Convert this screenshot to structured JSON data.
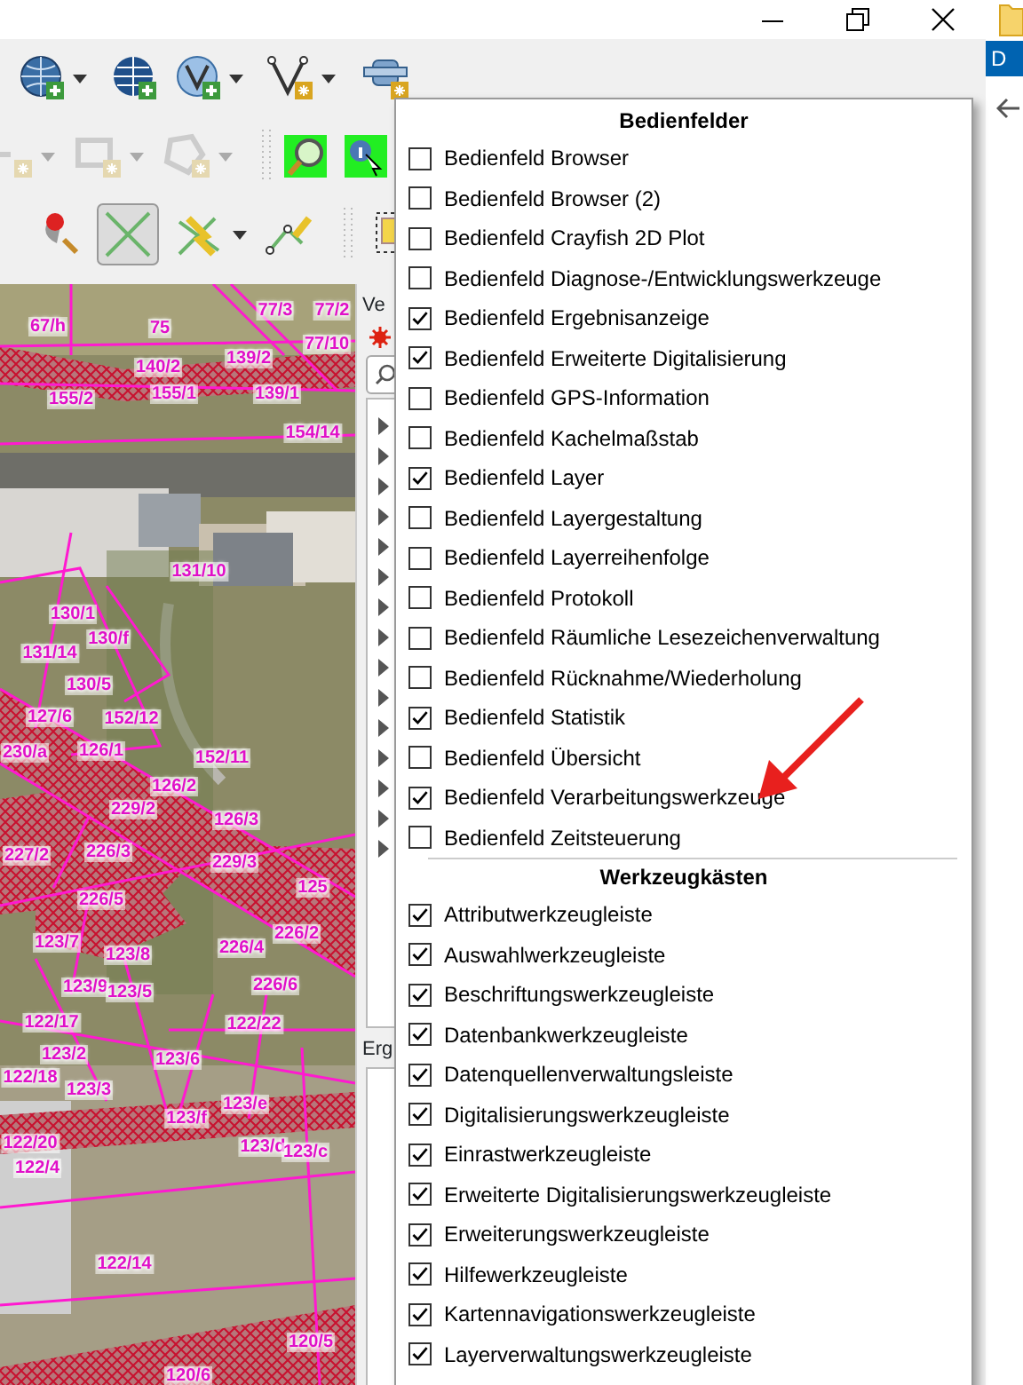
{
  "map": {
    "parcel_labels": [
      "67/h",
      "75",
      "77/3",
      "77/2",
      "77/10",
      "140/2",
      "139/2",
      "155/2",
      "155/1",
      "139/1",
      "154/14",
      "131/10",
      "130/1",
      "130/f",
      "131/14",
      "130/5",
      "127/6",
      "152/12",
      "230/a",
      "126/1",
      "152/11",
      "126/2",
      "229/2",
      "126/3",
      "227/2",
      "226/3",
      "229/3",
      "125",
      "226/5",
      "226/2",
      "123/7",
      "226/4",
      "123/8",
      "123/9",
      "123/5",
      "226/6",
      "122/17",
      "122/22",
      "123/2",
      "123/6",
      "122/18",
      "123/3",
      "123/e",
      "123/f",
      "122/20",
      "123/d",
      "123/c",
      "122/4",
      "122/14",
      "120/5",
      "120/6"
    ]
  },
  "panels": [
    {
      "title": "Ve"
    },
    {
      "title": "Erg"
    }
  ],
  "background_window": {
    "tab_label": "D"
  },
  "menu": {
    "sections": [
      {
        "title": "Bedienfelder",
        "items": [
          {
            "label": "Bedienfeld Browser",
            "checked": false
          },
          {
            "label": "Bedienfeld Browser (2)",
            "checked": false
          },
          {
            "label": "Bedienfeld Crayfish 2D Plot",
            "checked": false
          },
          {
            "label": "Bedienfeld Diagnose-/Entwicklungswerkzeuge",
            "checked": false
          },
          {
            "label": "Bedienfeld Ergebnisanzeige",
            "checked": true
          },
          {
            "label": "Bedienfeld Erweiterte Digitalisierung",
            "checked": true
          },
          {
            "label": "Bedienfeld GPS-Information",
            "checked": false
          },
          {
            "label": "Bedienfeld Kachelmaßstab",
            "checked": false
          },
          {
            "label": "Bedienfeld Layer",
            "checked": true
          },
          {
            "label": "Bedienfeld Layergestaltung",
            "checked": false
          },
          {
            "label": "Bedienfeld Layerreihenfolge",
            "checked": false
          },
          {
            "label": "Bedienfeld Protokoll",
            "checked": false
          },
          {
            "label": "Bedienfeld Räumliche Lesezeichenverwaltung",
            "checked": false
          },
          {
            "label": "Bedienfeld Rücknahme/Wiederholung",
            "checked": false
          },
          {
            "label": "Bedienfeld Statistik",
            "checked": true
          },
          {
            "label": "Bedienfeld Übersicht",
            "checked": false
          },
          {
            "label": "Bedienfeld Verarbeitungswerkzeuge",
            "checked": true
          },
          {
            "label": "Bedienfeld Zeitsteuerung",
            "checked": false
          }
        ]
      },
      {
        "title": "Werkzeugkästen",
        "items": [
          {
            "label": "Attributwerkzeugleiste",
            "checked": true
          },
          {
            "label": "Auswahlwerkzeugleiste",
            "checked": true
          },
          {
            "label": "Beschriftungswerkzeugleiste",
            "checked": true
          },
          {
            "label": "Datenbankwerkzeugleiste",
            "checked": true
          },
          {
            "label": "Datenquellenverwaltungsleiste",
            "checked": true
          },
          {
            "label": "Digitalisierungswerkzeugleiste",
            "checked": true
          },
          {
            "label": "Einrastwerkzeugleiste",
            "checked": true
          },
          {
            "label": "Erweiterte Digitalisierungswerkzeugleiste",
            "checked": true
          },
          {
            "label": "Erweiterungswerkzeugleiste",
            "checked": true
          },
          {
            "label": "Hilfewerkzeugleiste",
            "checked": true
          },
          {
            "label": "Kartennavigationswerkzeugleiste",
            "checked": true
          },
          {
            "label": "Layerverwaltungswerkzeugleiste",
            "checked": true
          }
        ]
      }
    ]
  }
}
